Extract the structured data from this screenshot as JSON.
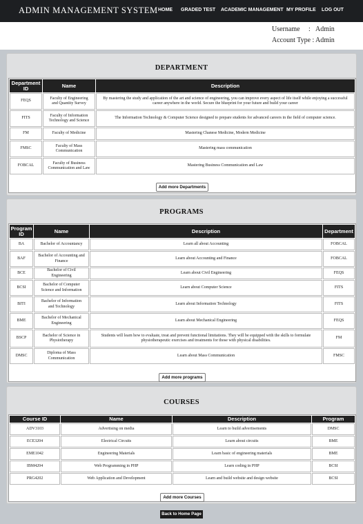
{
  "header": {
    "title": "ADMIN MANAGEMENT SYSTEM",
    "nav": [
      "HOME",
      "GRADED TEST",
      "ACADEMIC MANAGEMENT",
      "MY PROFILE",
      "LOG OUT"
    ]
  },
  "user": {
    "username_label": "Username",
    "username_sep": ":",
    "username_value": "Admin",
    "account_type_label": "Account Type :",
    "account_type_value": "Admin"
  },
  "department": {
    "title": "DEPARTMENT",
    "headers": [
      "Department ID",
      "Name",
      "Description"
    ],
    "rows": [
      [
        "FEQS",
        "Faculty of Engineering and Quantity Survey",
        "By mastering the study and application of the art and science of engineering, you can improve every aspect of life itself while enjoying a successful career anywhere in the world. Secure the blueprint for your future and build your career"
      ],
      [
        "FITS",
        "Faculty of Information Technology and Science",
        "The Information Technology & Computer Science designed to prepare students for advanced careers in the field of computer science."
      ],
      [
        "FM",
        "Faculty of Medicine",
        "Mastering Chanese Medicine, Modern Medicine"
      ],
      [
        "FMSC",
        "Faculty of Mass Communication",
        "Mastering mass communication"
      ],
      [
        "FOBCAL",
        "Faculty of Business Communication and Law",
        "Mastering Business Communication and Law"
      ]
    ],
    "add_button": "Add more Departments"
  },
  "programs": {
    "title": "PROGRAMS",
    "headers": [
      "Program ID",
      "Name",
      "Description",
      "Department"
    ],
    "rows": [
      [
        "BA",
        "Bachelor of Accountancy",
        "Learn all about Accounting",
        "FOBCAL"
      ],
      [
        "BAF",
        "Bachelor of Accounting and Finance",
        "Learn about Accounting and Finance",
        "FOBCAL"
      ],
      [
        "BCE",
        "Bachelor of Civil Engineering",
        "Learn about Civil Engineering",
        "FEQS"
      ],
      [
        "BCSI",
        "Bachelor of Computer Science and Information",
        "Learn about Computer Science",
        "FITS"
      ],
      [
        "BITI",
        "Bachelor of Information and Technology",
        "Learn about Information Technology",
        "FITS"
      ],
      [
        "BME",
        "Bachelor of Mechanical Engineering",
        "Learn about Mechanical Engineering",
        "FEQS"
      ],
      [
        "BSCP",
        "Bachelor of Science in Physiotherapy",
        "Students will learn how to evaluate, treat and prevent functional limitations. They will be equipped with the skills to formulate physiotherapeutic exercises and treatments for those with physical disabilities.",
        "FM"
      ],
      [
        "DMSC",
        "Diploma of Mass Communication",
        "Learn about Mass Communication",
        "FMSC"
      ]
    ],
    "add_button": "Add more programs"
  },
  "courses": {
    "title": "COURSES",
    "headers": [
      "Course ID",
      "Name",
      "Description",
      "Program"
    ],
    "rows": [
      [
        "ADV3103",
        "Advertising on media",
        "Learn to build advertisements",
        "DMSC"
      ],
      [
        "ECE3204",
        "Electrical Circuits",
        "Learn about circuits",
        "BME"
      ],
      [
        "EME1042",
        "Engineering Materials",
        "Learn basic of engineering materials",
        "BME"
      ],
      [
        "IBM4204",
        "Web Programming in PHP",
        "Learn coding in PHP",
        "BCSI"
      ],
      [
        "PRG4202",
        "Web Application and Development",
        "Learn and build website and design website",
        "BCSI"
      ]
    ],
    "add_button": "Add more Courses"
  },
  "footer": {
    "home_button": "Back to Home Page"
  }
}
